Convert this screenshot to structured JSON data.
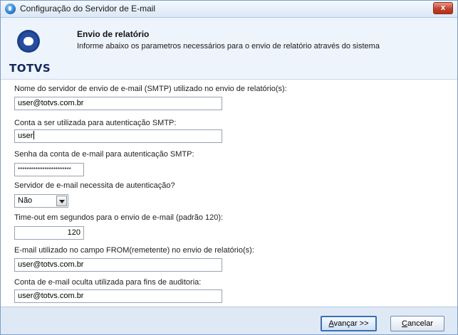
{
  "window": {
    "title": "Configuração do Servidor de E-mail",
    "close_label": "x"
  },
  "header": {
    "logo_text": "TOTVS",
    "title": "Envio de relatório",
    "description": "Informe abaixo os parametros necessários para o envio de relatório através do sistema"
  },
  "form": {
    "smtp_server": {
      "label": "Nome do servidor de envio de e-mail (SMTP) utilizado no envio de relatório(s):",
      "value": "user@totvs.com.br"
    },
    "smtp_account": {
      "label": "Conta a ser utilizada para autenticação SMTP:",
      "value": "user"
    },
    "smtp_password": {
      "label": "Senha da conta de e-mail para autenticação SMTP:",
      "value": "************************"
    },
    "requires_auth": {
      "label": "Servidor de e-mail necessita de autenticação?",
      "value": "Não"
    },
    "timeout": {
      "label": "Time-out em segundos para o envio de e-mail (padrão 120):",
      "value": "120"
    },
    "from_email": {
      "label": "E-mail utilizado no campo FROM(remetente) no envio de relatório(s):",
      "value": "user@totvs.com.br"
    },
    "audit_email": {
      "label": "Conta de e-mail oculta utilizada para fins de auditoria:",
      "value": "user@totvs.com.br"
    }
  },
  "footer": {
    "next_label_underlined": "A",
    "next_label_rest": "vançar >>",
    "cancel_label_underlined": "C",
    "cancel_label_rest": "ancelar"
  },
  "colors": {
    "logo_circle": "#1c3f86",
    "logo_inner": "#ffffff",
    "header_bg": "#eef4fc",
    "footer_bg": "#dfe9f6",
    "close_button": "#c2412b"
  },
  "icons": {
    "title_icon": "app-globe-icon",
    "logo": "totvs-logo",
    "dropdown_arrow": "chevron-down-icon"
  }
}
